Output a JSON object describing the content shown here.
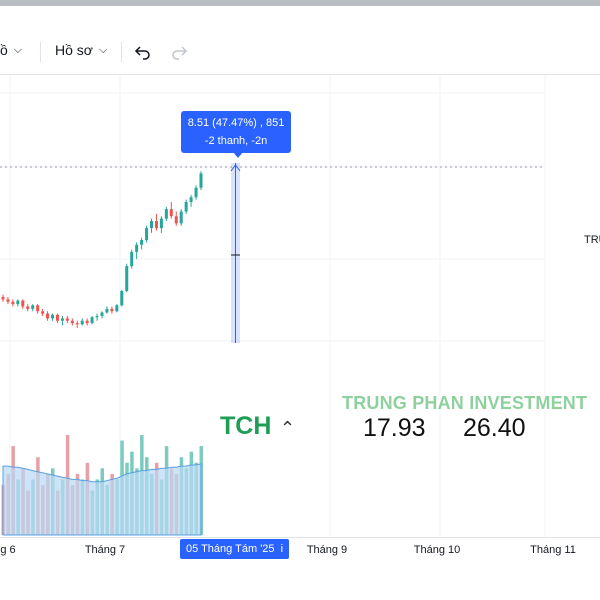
{
  "toolbar": {
    "item1_label": "ồ",
    "item2_label": "Hồ sơ"
  },
  "tooltip": {
    "line1": "8.51 (47.47%) , 851",
    "line2": "-2 thanh, -2n"
  },
  "axis": {
    "ticks": [
      "g 6",
      "Tháng 7",
      "Tháng 9",
      "Tháng 10",
      "Tháng 11"
    ],
    "active": "05 Tháng Tám '25",
    "active_suffix": "i"
  },
  "overlay": {
    "brand": "TRUNG PHAN INVESTMENT",
    "symbol": "TCH",
    "value1": "17.93",
    "value2": "26.40"
  },
  "right_label": "TRU",
  "colors": {
    "up": "#26a69a",
    "down": "#ef5350",
    "accent": "#2962ff"
  },
  "chart_data": {
    "type": "candlestick",
    "candles_ohlc": [
      [
        12.6,
        12.7,
        12.4,
        12.5
      ],
      [
        12.5,
        12.6,
        12.3,
        12.4
      ],
      [
        12.4,
        12.5,
        12.2,
        12.3
      ],
      [
        12.3,
        12.5,
        12.2,
        12.45
      ],
      [
        12.45,
        12.5,
        12.1,
        12.2
      ],
      [
        12.2,
        12.3,
        12.0,
        12.1
      ],
      [
        12.1,
        12.3,
        12.0,
        12.25
      ],
      [
        12.25,
        12.3,
        11.9,
        12.0
      ],
      [
        12.0,
        12.1,
        11.8,
        11.9
      ],
      [
        11.9,
        12.0,
        11.6,
        11.7
      ],
      [
        11.7,
        11.9,
        11.6,
        11.85
      ],
      [
        11.85,
        11.9,
        11.5,
        11.6
      ],
      [
        11.6,
        11.8,
        11.4,
        11.7
      ],
      [
        11.7,
        11.8,
        11.5,
        11.6
      ],
      [
        11.6,
        11.7,
        11.4,
        11.5
      ],
      [
        11.5,
        11.6,
        11.3,
        11.45
      ],
      [
        11.45,
        11.7,
        11.4,
        11.6
      ],
      [
        11.6,
        11.7,
        11.4,
        11.5
      ],
      [
        11.5,
        11.8,
        11.45,
        11.75
      ],
      [
        11.75,
        11.9,
        11.6,
        11.8
      ],
      [
        11.8,
        12.0,
        11.7,
        11.95
      ],
      [
        11.95,
        12.2,
        11.9,
        12.1
      ],
      [
        12.1,
        12.2,
        11.9,
        12.0
      ],
      [
        12.0,
        12.3,
        11.95,
        12.25
      ],
      [
        12.25,
        12.9,
        12.2,
        12.85
      ],
      [
        12.85,
        14.0,
        12.8,
        13.9
      ],
      [
        13.9,
        14.6,
        13.8,
        14.5
      ],
      [
        14.5,
        14.9,
        14.2,
        14.8
      ],
      [
        14.8,
        15.1,
        14.6,
        15.0
      ],
      [
        15.0,
        15.6,
        14.9,
        15.5
      ],
      [
        15.5,
        15.9,
        15.3,
        15.8
      ],
      [
        15.8,
        16.1,
        15.4,
        15.5
      ],
      [
        15.5,
        16.0,
        15.3,
        15.9
      ],
      [
        15.9,
        16.4,
        15.8,
        16.3
      ],
      [
        16.3,
        16.6,
        15.9,
        16.0
      ],
      [
        16.0,
        16.2,
        15.6,
        15.7
      ],
      [
        15.7,
        16.3,
        15.6,
        16.2
      ],
      [
        16.2,
        16.7,
        16.1,
        16.6
      ],
      [
        16.6,
        16.9,
        16.4,
        16.8
      ],
      [
        16.8,
        17.3,
        16.7,
        17.2
      ],
      [
        17.2,
        17.9,
        17.1,
        17.8
      ]
    ],
    "volume": [
      0.45,
      0.55,
      0.8,
      0.5,
      0.6,
      0.4,
      0.5,
      0.7,
      0.45,
      0.55,
      0.6,
      0.4,
      0.5,
      0.9,
      0.45,
      0.55,
      0.5,
      0.65,
      0.4,
      0.5,
      0.6,
      0.45,
      0.55,
      0.5,
      0.85,
      0.65,
      0.75,
      0.6,
      0.9,
      0.7,
      0.55,
      0.65,
      0.5,
      0.8,
      0.6,
      0.55,
      0.7,
      0.6,
      0.75,
      0.65,
      0.8
    ],
    "volume_ma": [
      0.62,
      0.62,
      0.61,
      0.61,
      0.6,
      0.59,
      0.58,
      0.57,
      0.56,
      0.55,
      0.54,
      0.53,
      0.52,
      0.51,
      0.5,
      0.5,
      0.49,
      0.49,
      0.48,
      0.48,
      0.48,
      0.49,
      0.5,
      0.51,
      0.53,
      0.55,
      0.56,
      0.57,
      0.58,
      0.58,
      0.59,
      0.59,
      0.6,
      0.6,
      0.61,
      0.61,
      0.62,
      0.62,
      0.63,
      0.63,
      0.64
    ],
    "price_range": [
      11.0,
      19.0
    ]
  }
}
